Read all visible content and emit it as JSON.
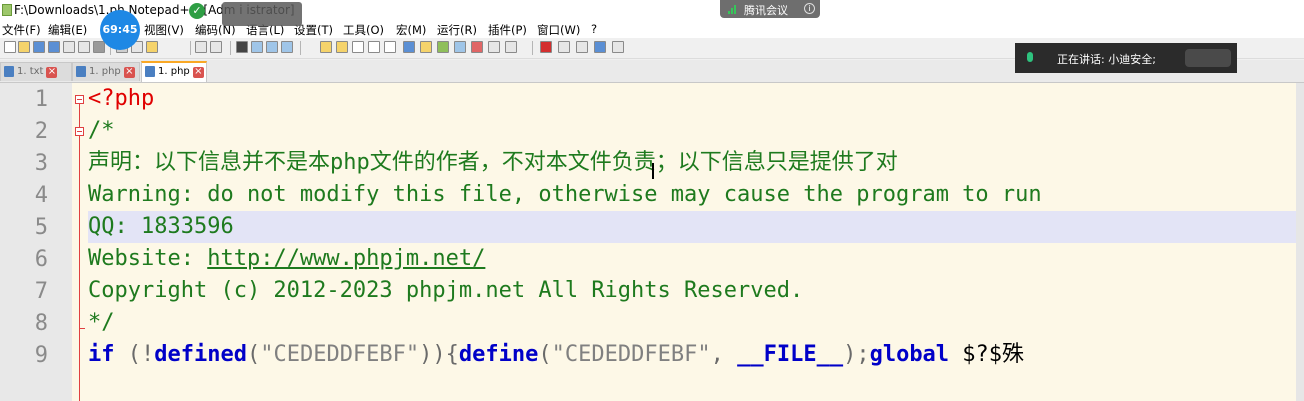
{
  "window": {
    "title": "F:\\Downloads\\1.ph Notepad++ [Adm i istrator]"
  },
  "menu": [
    "文件(F)",
    "编辑(E)",
    "视图(V)",
    "编码(N)",
    "语言(L)",
    "设置(T)",
    "工具(O)",
    "宏(M)",
    "运行(R)",
    "插件(P)",
    "窗口(W)",
    "?"
  ],
  "tabs": [
    {
      "label": "1. txt",
      "active": false
    },
    {
      "label": "1. php",
      "active": false
    },
    {
      "label": "1. php",
      "active": true
    }
  ],
  "editor": {
    "line_numbers": [
      "1",
      "2",
      "3",
      "4",
      "5",
      "6",
      "7",
      "8",
      "9"
    ],
    "line1": {
      "text": "<?php"
    },
    "line2": {
      "text": "/*"
    },
    "line3": {
      "text": "声明：以下信息并不是本php文件的作者，不对本文件负责；以下信息只是提供了对"
    },
    "line4": {
      "text": "Warning: do not modify this file, otherwise may cause the program to run"
    },
    "line5": {
      "text": "QQ: 1833596"
    },
    "line6": {
      "prefix": "Website: ",
      "url": "http://www.phpjm.net/"
    },
    "line7": {
      "text": "Copyright (c) 2012-2023 phpjm.net All Rights Reserved."
    },
    "line8": {
      "text": "*/"
    },
    "line9": {
      "kw_if": "if",
      "p1": " (!",
      "kw_defined": "defined",
      "p2": "(",
      "str1": "\"CEDEDDFEBF\"",
      "p3": ")){",
      "kw_define": "define",
      "p4": "(",
      "str2": "\"CEDEDDFEBF\"",
      "p5": ", ",
      "kw_file": "__FILE__",
      "p6": ");",
      "kw_global": "global",
      "var": " $?$殊"
    }
  },
  "overlays": {
    "timer": "69:45",
    "meeting_app": "腾讯会议",
    "speaking_label": "正在讲话: 小迪安全;"
  },
  "colors": {
    "editor_bg": "#fdf8e7",
    "comment": "#1e7a1e",
    "keyword": "#0000c8",
    "php_tag": "#e00000",
    "line_highlight": "#e3e4f6"
  }
}
